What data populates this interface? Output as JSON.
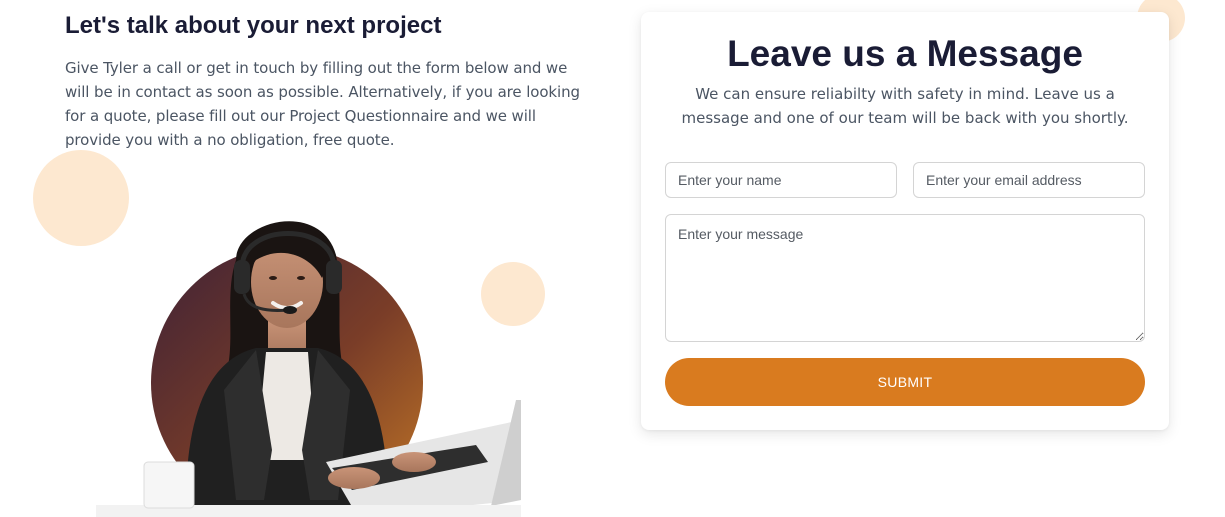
{
  "contact_intro": {
    "title": "Let's talk about your next project",
    "body": "Give Tyler a call or get in touch by filling out the form below and we will be in contact as soon as possible. Alternatively, if you are looking for a quote, please fill out our Project Questionnaire and we will provide you with a no obligation, free quote."
  },
  "illustration": {
    "subject": "support-agent-with-headset-at-laptop"
  },
  "form": {
    "title": "Leave us a Message",
    "subtitle": "We can ensure reliabilty with safety in mind. Leave us a message and one of our team will be back with you shortly.",
    "name_placeholder": "Enter your name",
    "email_placeholder": "Enter your email address",
    "message_placeholder": "Enter your message",
    "submit_label": "SUBMIT"
  },
  "colors": {
    "accent": "#d97b1f",
    "heading": "#1a1c35",
    "body_text": "#4b5563",
    "decor_circle": "#fde8d0"
  }
}
